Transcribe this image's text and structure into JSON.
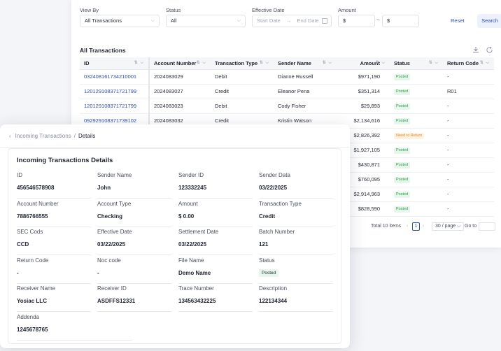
{
  "filters": {
    "view_by": {
      "label": "View By",
      "value": "All Transactions"
    },
    "status": {
      "label": "Status",
      "value": "All"
    },
    "effective_date": {
      "label": "Effective Date",
      "start_placeholder": "Start Date",
      "arrow": "→",
      "end_placeholder": "End Date"
    },
    "amount": {
      "label": "Amount",
      "min_prefix": "$",
      "dash": "~",
      "max_prefix": "$"
    },
    "reset_label": "Reset",
    "search_label": "Search"
  },
  "list": {
    "title": "All Transactions",
    "columns": [
      "ID",
      "Account Number",
      "Transaction Type",
      "Sender Name",
      "Amount",
      "Status",
      "Return Code"
    ],
    "rows": [
      [
        "032408161734210001",
        "2024083029",
        "Debit",
        "Dianne Russell",
        "$971,190",
        "Posted",
        "-"
      ],
      [
        "120129108371721799",
        "2024083027",
        "Credit",
        "Eleanor Pena",
        "$351,314",
        "Posted",
        "R01"
      ],
      [
        "120129108371721799",
        "2024083023",
        "Debit",
        "Cody Fisher",
        "$29,893",
        "Posted",
        "-"
      ],
      [
        "092929108371739102",
        "2024083032",
        "Credit",
        "Kristin Watson",
        "$2,134,616",
        "Posted",
        "-"
      ],
      [
        "",
        "",
        "",
        "",
        "$2,826,392",
        "Need to Return",
        "-"
      ],
      [
        "",
        "",
        "",
        "",
        "$1,927,105",
        "Posted",
        "-"
      ],
      [
        "",
        "",
        "",
        "",
        "$430,871",
        "Posted",
        "-"
      ],
      [
        "",
        "",
        "",
        "",
        "$760,095",
        "Posted",
        "-"
      ],
      [
        "",
        "",
        "",
        "",
        "$2,914,963",
        "Posted",
        "-"
      ],
      [
        "",
        "",
        "",
        "",
        "$828,590",
        "Posted",
        "-"
      ]
    ],
    "pagination": {
      "total": "Total 10 items",
      "prev": "‹",
      "current": "1",
      "next": "›",
      "page_size": "30 / page",
      "goto_label": "Go to"
    }
  },
  "breadcrumb": {
    "back": "‹",
    "parent": "Incoming Transactions",
    "separator": "/",
    "current": "Details"
  },
  "details": {
    "title": "Incoming Transactions Details",
    "fields": [
      {
        "label": "ID",
        "value": "456546578908"
      },
      {
        "label": "Sender Name",
        "value": "John"
      },
      {
        "label": "Sender ID",
        "value": "123332245"
      },
      {
        "label": "Sender Data",
        "value": "03/22/2025"
      },
      {
        "label": "Account Number",
        "value": "7886766555"
      },
      {
        "label": "Account Type",
        "value": "Checking"
      },
      {
        "label": "Amount",
        "value": "$ 0.00"
      },
      {
        "label": "Transaction Type",
        "value": "Credit"
      },
      {
        "label": "SEC Cods",
        "value": "CCD"
      },
      {
        "label": "Effective Date",
        "value": "03/22/2025"
      },
      {
        "label": "Settlement Date",
        "value": "03/22/2025"
      },
      {
        "label": "Batch Number",
        "value": "121"
      },
      {
        "label": "Return Code",
        "value": "-"
      },
      {
        "label": "Noc code",
        "value": "-"
      },
      {
        "label": "File Name",
        "value": "Demo Name"
      },
      {
        "label": "Status",
        "value": "Posted"
      },
      {
        "label": "Receiver Name",
        "value": "Yosiac LLC"
      },
      {
        "label": "Receiver ID",
        "value": "ASDFFS12331"
      },
      {
        "label": "Trace Number",
        "value": "134563432225"
      },
      {
        "label": "Description",
        "value": "122134344"
      },
      {
        "label": "Addenda",
        "value": "1245678765"
      }
    ]
  },
  "colors": {
    "accent": "#2c4fb4",
    "posted_bg": "#e6f6ea",
    "posted_fg": "#2f9e4a",
    "warn_bg": "#fdf1e2",
    "warn_fg": "#e08a23"
  }
}
